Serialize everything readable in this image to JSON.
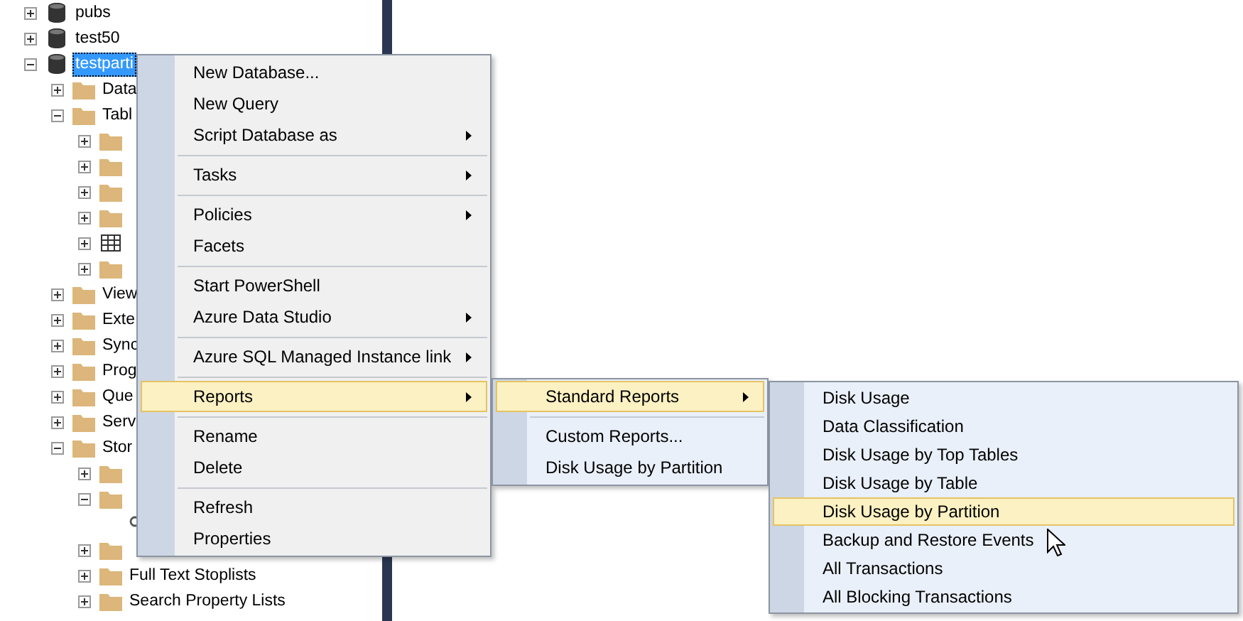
{
  "tree": [
    {
      "label": "pubs",
      "kind": "database",
      "expanded": false,
      "selected": false
    },
    {
      "label": "test50",
      "kind": "database",
      "expanded": false,
      "selected": false
    },
    {
      "label": "testparti",
      "kind": "database",
      "expanded": true,
      "selected": true,
      "children": [
        {
          "label": "Data",
          "kind": "folder",
          "expanded": false,
          "selected": false
        },
        {
          "label": "Tabl",
          "kind": "folder",
          "expanded": true,
          "selected": false,
          "children": [
            {
              "kind": "folder",
              "expanded": false
            },
            {
              "kind": "folder",
              "expanded": false
            },
            {
              "kind": "folder",
              "expanded": false
            },
            {
              "kind": "folder",
              "expanded": false
            },
            {
              "kind": "table",
              "expanded": false
            },
            {
              "kind": "folder",
              "expanded": false
            }
          ]
        },
        {
          "label": "View",
          "kind": "folder",
          "expanded": false,
          "selected": false
        },
        {
          "label": "Exte",
          "kind": "folder",
          "expanded": false,
          "selected": false
        },
        {
          "label": "Sync",
          "kind": "folder",
          "expanded": false,
          "selected": false
        },
        {
          "label": "Prog",
          "kind": "folder",
          "expanded": false,
          "selected": false
        },
        {
          "label": "Que",
          "kind": "folder",
          "expanded": false,
          "selected": false
        },
        {
          "label": "Serv",
          "kind": "folder",
          "expanded": false,
          "selected": false
        },
        {
          "label": "Stor",
          "kind": "folder",
          "expanded": true,
          "selected": false,
          "children": [
            {
              "kind": "folder",
              "expanded": false
            },
            {
              "kind": "folder",
              "expanded": true,
              "children": [
                {
                  "kind": "key"
                }
              ]
            },
            {
              "kind": "folder",
              "expanded": false
            },
            {
              "label": "Full Text Stoplists",
              "kind": "folder",
              "expanded": false,
              "selected": false
            },
            {
              "label": "Search Property Lists",
              "kind": "folder",
              "expanded": false,
              "selected": false
            }
          ]
        }
      ]
    }
  ],
  "menus": [
    {
      "items": [
        {
          "kind": "item",
          "label": "New Database...",
          "submenu": false,
          "selected": false
        },
        {
          "kind": "item",
          "label": "New Query",
          "submenu": false,
          "selected": false
        },
        {
          "kind": "item",
          "label": "Script Database as",
          "submenu": true,
          "selected": false
        },
        {
          "kind": "separator"
        },
        {
          "kind": "item",
          "label": "Tasks",
          "submenu": true,
          "selected": false
        },
        {
          "kind": "separator"
        },
        {
          "kind": "item",
          "label": "Policies",
          "submenu": true,
          "selected": false
        },
        {
          "kind": "item",
          "label": "Facets",
          "submenu": false,
          "selected": false
        },
        {
          "kind": "separator"
        },
        {
          "kind": "item",
          "label": "Start PowerShell",
          "submenu": false,
          "selected": false
        },
        {
          "kind": "item",
          "label": "Azure Data Studio",
          "submenu": true,
          "selected": false
        },
        {
          "kind": "separator"
        },
        {
          "kind": "item",
          "label": "Azure SQL Managed Instance link",
          "submenu": true,
          "selected": false
        },
        {
          "kind": "separator"
        },
        {
          "kind": "item",
          "label": "Reports",
          "submenu": true,
          "selected": true
        },
        {
          "kind": "separator"
        },
        {
          "kind": "item",
          "label": "Rename",
          "submenu": false,
          "selected": false
        },
        {
          "kind": "item",
          "label": "Delete",
          "submenu": false,
          "selected": false
        },
        {
          "kind": "separator"
        },
        {
          "kind": "item",
          "label": "Refresh",
          "submenu": false,
          "selected": false
        },
        {
          "kind": "item",
          "label": "Properties",
          "submenu": false,
          "selected": false
        }
      ]
    },
    {
      "items": [
        {
          "kind": "item",
          "label": "Standard Reports",
          "submenu": true,
          "selected": true
        },
        {
          "kind": "separator"
        },
        {
          "kind": "item",
          "label": "Custom Reports...",
          "submenu": false,
          "selected": false
        },
        {
          "kind": "item",
          "label": "Disk Usage by Partition",
          "submenu": false,
          "selected": false
        }
      ]
    },
    {
      "items": [
        {
          "kind": "item",
          "label": "Disk Usage",
          "submenu": false,
          "selected": false
        },
        {
          "kind": "item",
          "label": "Data Classification",
          "submenu": false,
          "selected": false
        },
        {
          "kind": "item",
          "label": "Disk Usage by Top Tables",
          "submenu": false,
          "selected": false
        },
        {
          "kind": "item",
          "label": "Disk Usage by Table",
          "submenu": false,
          "selected": false
        },
        {
          "kind": "item",
          "label": "Disk Usage by Partition",
          "submenu": false,
          "selected": true
        },
        {
          "kind": "item",
          "label": "Backup and Restore Events",
          "submenu": false,
          "selected": false
        },
        {
          "kind": "item",
          "label": "All Transactions",
          "submenu": false,
          "selected": false
        },
        {
          "kind": "item",
          "label": "All Blocking Transactions",
          "submenu": false,
          "selected": false
        }
      ]
    }
  ]
}
